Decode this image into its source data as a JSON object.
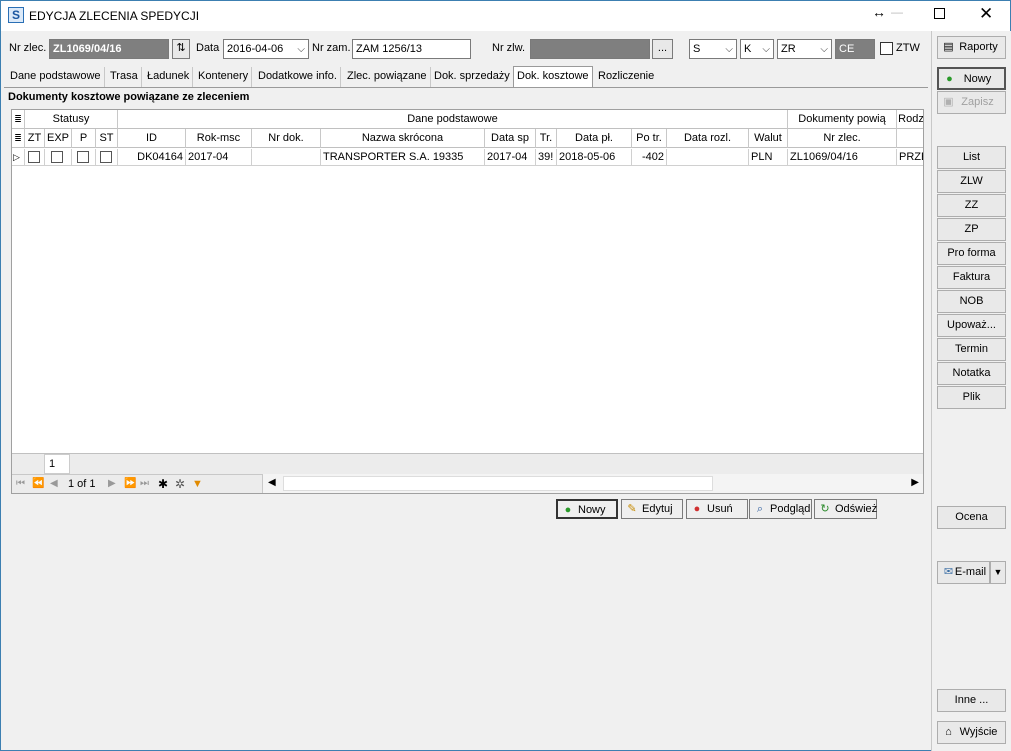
{
  "window": {
    "title": "EDYCJA ZLECENIA SPEDYCJI",
    "app_icon_letter": "S"
  },
  "header": {
    "nr_zlec_label": "Nr zlec.",
    "nr_zlec_value": "ZL1069/04/16",
    "data_label": "Data",
    "data_value": "2016-04-06",
    "nr_zam_label": "Nr zam.",
    "nr_zam_value": "ZAM 1256/13",
    "nr_zlw_label": "Nr zlw.",
    "nr_zlw_value": "",
    "browse_btn": "...",
    "select_s": "S",
    "select_k": "K",
    "select_zr": "ZR",
    "field_ce": "CE",
    "ztw_label": "ZTW"
  },
  "tabs": [
    {
      "label": "Dane podstawowe",
      "active": false
    },
    {
      "label": "Trasa",
      "active": false
    },
    {
      "label": "Ładunek",
      "active": false
    },
    {
      "label": "Kontenery",
      "active": false
    },
    {
      "label": "Dodatkowe info.",
      "active": false
    },
    {
      "label": "Zlec. powiązane",
      "active": false
    },
    {
      "label": "Dok. sprzedaży",
      "active": false
    },
    {
      "label": "Dok. kosztowe",
      "active": true
    },
    {
      "label": "Rozliczenie",
      "active": false
    }
  ],
  "panel": {
    "section_title": "Dokumenty kosztowe powiązane ze zleceniem"
  },
  "grid": {
    "group_headers": {
      "statusy": "Statusy",
      "dane": "Dane podstawowe",
      "dokumenty": "Dokumenty powią",
      "rodz": "Rodz"
    },
    "columns": [
      "ZT",
      "EXP",
      "P",
      "ST",
      "ID",
      "Rok-msc",
      "Nr dok.",
      "Nazwa skrócona",
      "Data sp",
      "Tr.",
      "Data pł.",
      "Po tr.",
      "Data rozl.",
      "Walut",
      "Nr zlec."
    ],
    "rows": [
      {
        "id": "DK04164",
        "rok_msc": "2017-04",
        "nr_dok": "",
        "nazwa": "TRANSPORTER S.A. 19335",
        "data_sp": "2017-04",
        "tr": "39!",
        "data_pl": "2018-05-06",
        "po_tr": "-402",
        "data_rozl": "",
        "waluta": "PLN",
        "nr_zlec": "ZL1069/04/16",
        "rodz": "PRZE"
      }
    ],
    "footer_count": "1",
    "pager_text": "1 of 1"
  },
  "actions": {
    "nowy": "Nowy",
    "edytuj": "Edytuj",
    "usun": "Usuń",
    "podglad": "Podgląd",
    "odswiez": "Odśwież"
  },
  "sidebar": {
    "raporty": "Raporty",
    "nowy": "Nowy",
    "zapisz": "Zapisz",
    "list": "List",
    "zlw": "ZLW",
    "zz": "ZZ",
    "zp": "ZP",
    "pro_forma": "Pro forma",
    "faktura": "Faktura",
    "nob": "NOB",
    "upowaz": "Upoważ...",
    "termin": "Termin",
    "notatka": "Notatka",
    "plik": "Plik",
    "ocena": "Ocena",
    "email": "E-mail",
    "inne": "Inne ...",
    "wyjscie": "Wyjście"
  }
}
